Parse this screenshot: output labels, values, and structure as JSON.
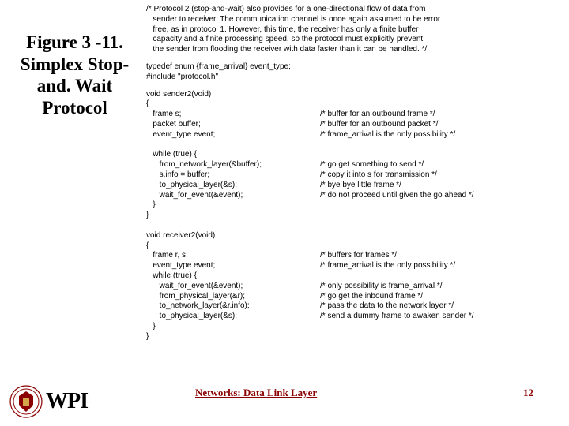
{
  "title": "Figure 3 -11. Simplex Stop-and. Wait Protocol",
  "code": {
    "comment": [
      "/* Protocol 2 (stop-and-wait) also provides for a one-directional flow of data from",
      "   sender to receiver. The communication channel is once again assumed to be error",
      "   free, as in protocol 1. However, this time, the receiver has only a finite buffer",
      "   capacity and a finite processing speed, so the protocol must explicitly prevent",
      "   the sender from flooding the receiver with data faster than it can be handled. */"
    ],
    "decl": [
      "typedef enum {frame_arrival} event_type;",
      "#include \"protocol.h\""
    ],
    "sender_head": [
      "void sender2(void)",
      "{"
    ],
    "sender_vars": [
      {
        "left": "   frame s;",
        "right": "/* buffer for an outbound frame */"
      },
      {
        "left": "   packet buffer;",
        "right": "/* buffer for an outbound packet */"
      },
      {
        "left": "   event_type event;",
        "right": "/* frame_arrival is the only possibility */"
      }
    ],
    "sender_loop_open": "   while (true) {",
    "sender_loop_body": [
      {
        "left": "      from_network_layer(&buffer);",
        "right": "/* go get something to send */"
      },
      {
        "left": "      s.info = buffer;",
        "right": "/* copy it into s for transmission */"
      },
      {
        "left": "      to_physical_layer(&s);",
        "right": "/* bye bye little frame */"
      },
      {
        "left": "      wait_for_event(&event);",
        "right": "/* do not proceed until given the go ahead */"
      }
    ],
    "sender_close": [
      "   }",
      "}"
    ],
    "receiver_head": [
      "void receiver2(void)",
      "{"
    ],
    "receiver_vars": [
      {
        "left": "   frame r, s;",
        "right": "/* buffers for frames */"
      },
      {
        "left": "   event_type event;",
        "right": "/* frame_arrival is the only possibility */"
      }
    ],
    "receiver_loop_open": "   while (true) {",
    "receiver_loop_body": [
      {
        "left": "      wait_for_event(&event);",
        "right": "/* only possibility is frame_arrival */"
      },
      {
        "left": "      from_physical_layer(&r);",
        "right": "/* go get the inbound frame */"
      },
      {
        "left": "      to_network_layer(&r.info);",
        "right": "/* pass the data to the network layer */"
      },
      {
        "left": "      to_physical_layer(&s);",
        "right": "/* send a dummy frame to awaken sender */"
      }
    ],
    "receiver_close": [
      "   }",
      "}"
    ]
  },
  "footer": "Networks: Data Link Layer",
  "page": "12",
  "logo_text": "WPI"
}
